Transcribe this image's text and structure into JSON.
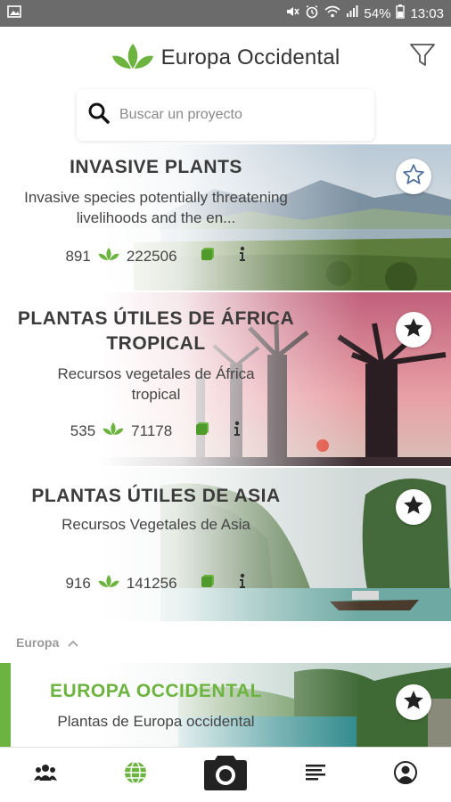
{
  "status_bar": {
    "battery": "54%",
    "time": "13:03",
    "icons": [
      "image-icon",
      "mute-icon",
      "alarm-icon",
      "wifi-icon",
      "signal-icon",
      "battery-icon"
    ]
  },
  "header": {
    "title": "Europa Occidental",
    "logo_icon": "plantnet-leaf-icon",
    "filter_icon": "filter-icon"
  },
  "search": {
    "placeholder": "Buscar un proyecto"
  },
  "colors": {
    "brand_green": "#6cb33f",
    "status_bar": "#6b6b6b",
    "text_dark": "#3b3b3b"
  },
  "projects": [
    {
      "title": "INVASIVE PLANTS",
      "description": "Invasive species potentially threatening livelihoods and the en...",
      "species_count": "891",
      "images_count": "222506",
      "favorite": false
    },
    {
      "title": "PLANTAS ÚTILES DE ÁFRICA TROPICAL",
      "description": "Recursos vegetales de África tropical",
      "species_count": "535",
      "images_count": "71178",
      "favorite": true
    },
    {
      "title": "PLANTAS ÚTILES DE ASIA",
      "description": "Recursos Vegetales de Asia",
      "species_count": "916",
      "images_count": "141256",
      "favorite": true
    }
  ],
  "section": {
    "label": "Europa"
  },
  "active_project": {
    "title": "EUROPA OCCIDENTAL",
    "description": "Plantas de Europa occidental",
    "favorite": true
  },
  "bottom_nav": [
    "groups-icon",
    "globe-icon",
    "camera-icon",
    "list-icon",
    "profile-icon"
  ]
}
